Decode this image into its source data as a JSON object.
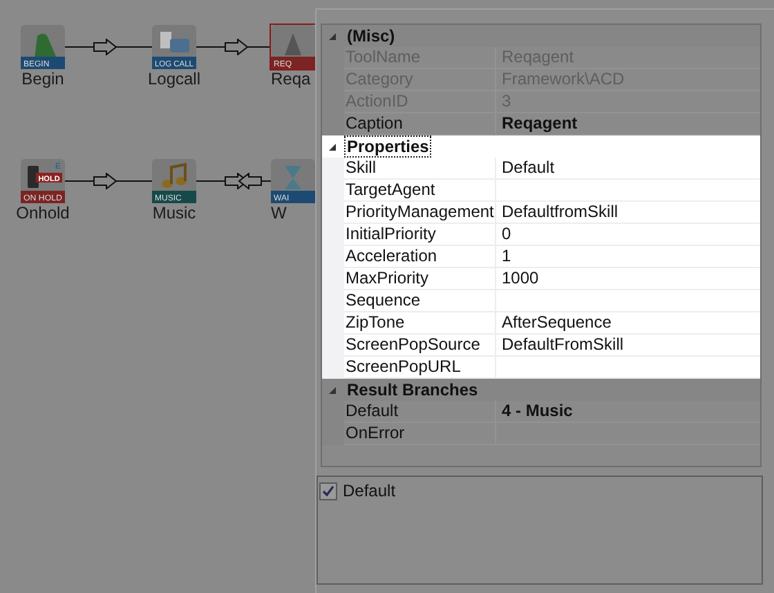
{
  "canvas": {
    "nodes": [
      {
        "label": "Begin",
        "badge": "BEGIN",
        "kind": "flag",
        "selected": false
      },
      {
        "label": "Logcall",
        "badge": "LOG CALL",
        "kind": "phone",
        "selected": false
      },
      {
        "label": "Reqa",
        "badge": "REQ",
        "kind": "agent",
        "selected": true
      },
      {
        "label": "Onhold",
        "badge": "ON HOLD",
        "kind": "hold",
        "selected": false,
        "tag": "HOLD",
        "corner": "E"
      },
      {
        "label": "Music",
        "badge": "MUSIC",
        "kind": "music",
        "selected": false
      },
      {
        "label": "W",
        "badge": "WAI",
        "kind": "wait",
        "selected": false
      }
    ],
    "connectors": [
      {
        "kind": "forward"
      },
      {
        "kind": "forward"
      },
      {
        "kind": "forward"
      },
      {
        "kind": "both"
      }
    ]
  },
  "property_grid": {
    "categories": [
      {
        "name": "(Misc)",
        "expanded": true,
        "highlighted": false,
        "focused": false,
        "rows": [
          {
            "name": "ToolName",
            "value": "Reqagent",
            "readonly": true,
            "modified": false
          },
          {
            "name": "Category",
            "value": "Framework\\ACD",
            "readonly": true,
            "modified": false
          },
          {
            "name": "ActionID",
            "value": "3",
            "readonly": true,
            "modified": false
          },
          {
            "name": "Caption",
            "value": "Reqagent",
            "readonly": false,
            "modified": true
          }
        ]
      },
      {
        "name": "Properties",
        "expanded": true,
        "highlighted": true,
        "focused": true,
        "rows": [
          {
            "name": "Skill",
            "value": "Default",
            "readonly": false,
            "modified": false
          },
          {
            "name": "TargetAgent",
            "readonly": false,
            "modified": false
          },
          {
            "name": "PriorityManagement",
            "value": "DefaultfromSkill",
            "readonly": false,
            "modified": false
          },
          {
            "name": "InitialPriority",
            "value": "0",
            "readonly": false,
            "modified": false
          },
          {
            "name": "Acceleration",
            "value": "1",
            "readonly": false,
            "modified": false
          },
          {
            "name": "MaxPriority",
            "value": "1000",
            "readonly": false,
            "modified": false
          },
          {
            "name": "Sequence",
            "readonly": false,
            "modified": false
          },
          {
            "name": "ZipTone",
            "value": "AfterSequence",
            "readonly": false,
            "modified": false
          },
          {
            "name": "ScreenPopSource",
            "value": "DefaultFromSkill",
            "readonly": false,
            "modified": false
          },
          {
            "name": "ScreenPopURL",
            "readonly": false,
            "modified": false
          }
        ]
      },
      {
        "name": "Result Branches",
        "expanded": true,
        "highlighted": false,
        "focused": false,
        "rows": [
          {
            "name": "Default",
            "value": "4 - Music",
            "readonly": false,
            "modified": true
          },
          {
            "name": "OnError",
            "readonly": false,
            "modified": false
          }
        ]
      }
    ]
  },
  "branches": [
    {
      "label": "Default",
      "checked": true
    }
  ]
}
